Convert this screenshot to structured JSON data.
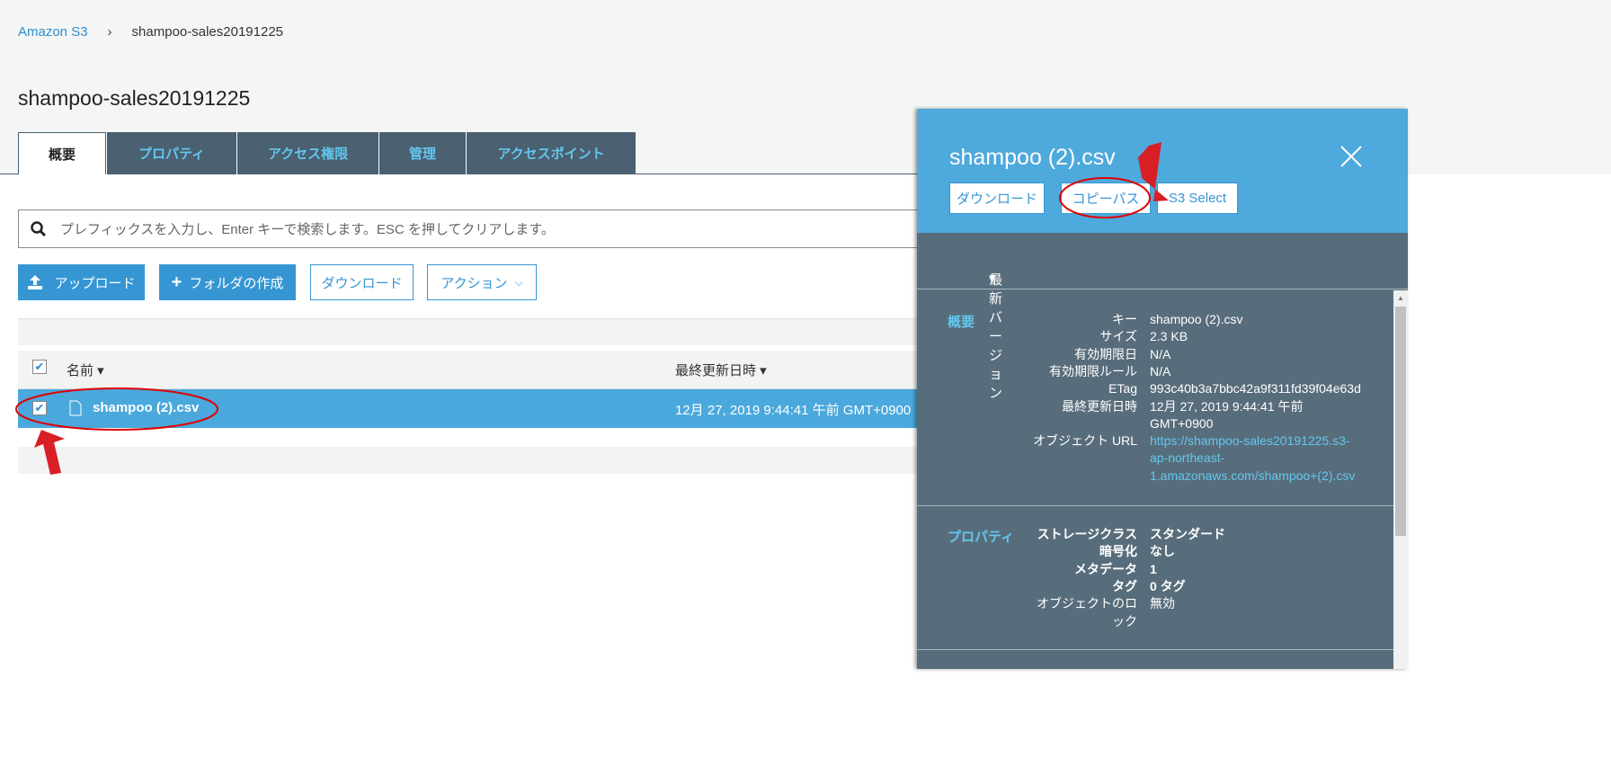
{
  "breadcrumb": {
    "root": "Amazon S3",
    "current": "shampoo-sales20191225"
  },
  "page_title": "shampoo-sales20191225",
  "tabs": [
    "概要",
    "プロパティ",
    "アクセス権限",
    "管理",
    "アクセスポイント"
  ],
  "search": {
    "placeholder": "プレフィックスを入力し、Enter キーで検索します。ESC を押してクリアします。"
  },
  "toolbar": {
    "upload": "アップロード",
    "create_folder": "フォルダの作成",
    "download": "ダウンロード",
    "actions": "アクション"
  },
  "table": {
    "headers": {
      "name": "名前",
      "modified": "最終更新日時"
    },
    "rows": [
      {
        "name": "shampoo (2).csv",
        "modified": "12月 27, 2019 9:44:41 午前 GMT+0900",
        "selected": true
      }
    ]
  },
  "panel": {
    "title": "shampoo (2).csv",
    "buttons": {
      "download": "ダウンロード",
      "copy_path": "コピーパス",
      "s3_select": "S3 Select"
    },
    "version": "最新バージョン",
    "overview": {
      "section": "概要",
      "key_label": "キー",
      "key": "shampoo (2).csv",
      "size_label": "サイズ",
      "size": "2.3 KB",
      "expiry_label": "有効期限日",
      "expiry": "N/A",
      "expiry_rule_label": "有効期限ルール",
      "expiry_rule": "N/A",
      "etag_label": "ETag",
      "etag": "993c40b3a7bbc42a9f311fd39f04e63d",
      "modified_label": "最終更新日時",
      "modified_1": "12月 27, 2019 9:44:41 午前",
      "modified_2": "GMT+0900",
      "url_label": "オブジェクト URL",
      "url_1": "https://shampoo-sales20191225.s3-",
      "url_2": "ap-northeast-",
      "url_3": "1.amazonaws.com/shampoo+(2).csv"
    },
    "properties": {
      "section": "プロパティ",
      "storage_label": "ストレージクラス",
      "storage": "スタンダード",
      "encryption_label": "暗号化",
      "encryption": "なし",
      "metadata_label": "メタデータ",
      "metadata": "1",
      "tags_label": "タグ",
      "tags": "0 タグ",
      "lock_label_1": "オブジェクトのロ",
      "lock_label_2": "ック",
      "lock": "無効"
    }
  },
  "colors": {
    "accent": "#3596d3",
    "tab_bg": "#4b6070",
    "panel_bg": "#586d7b",
    "link": "#62c7ef",
    "annotation": "#e00000"
  }
}
